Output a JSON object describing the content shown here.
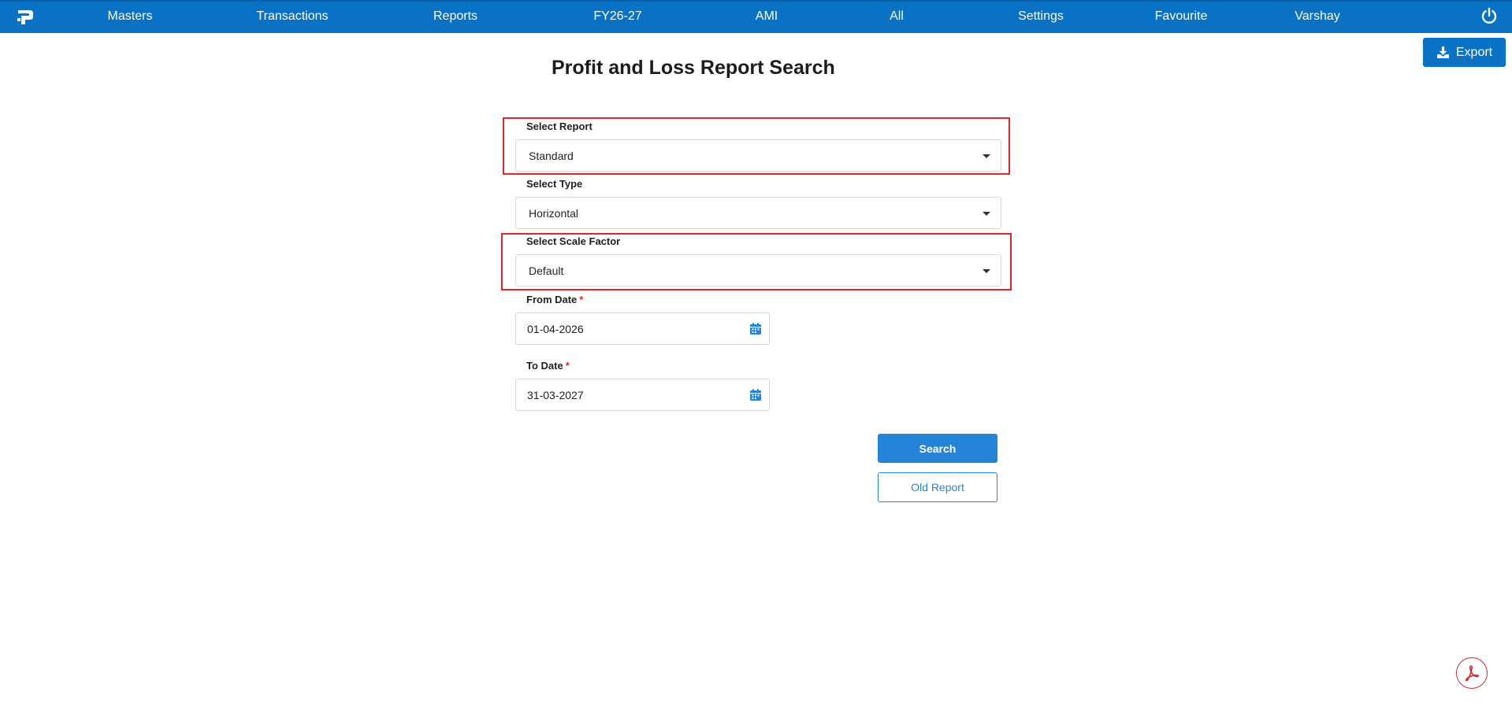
{
  "nav": {
    "items": [
      "Masters",
      "Transactions",
      "Reports",
      "FY26-27",
      "AMI",
      "All",
      "Settings",
      "Favourite",
      "Varshay"
    ]
  },
  "toolbar": {
    "export_label": "Export"
  },
  "page": {
    "title": "Profit and Loss Report Search"
  },
  "form": {
    "select_report": {
      "label": "Select Report",
      "value": "Standard"
    },
    "select_type": {
      "label": "Select Type",
      "value": "Horizontal"
    },
    "select_scale_factor": {
      "label": "Select Scale Factor",
      "value": "Default"
    },
    "from_date": {
      "label": "From Date",
      "required_mark": "*",
      "value": "01-04-2026"
    },
    "to_date": {
      "label": "To Date",
      "required_mark": "*",
      "value": "31-03-2027"
    }
  },
  "actions": {
    "search_label": "Search",
    "old_report_label": "Old Report"
  },
  "colors": {
    "brand": "#0a72c4",
    "button": "#2484d8",
    "highlight": "#e0262c"
  },
  "icons": [
    "app-logo",
    "power-icon",
    "download-icon",
    "caret-down-icon",
    "calendar-icon",
    "pdf-icon"
  ]
}
